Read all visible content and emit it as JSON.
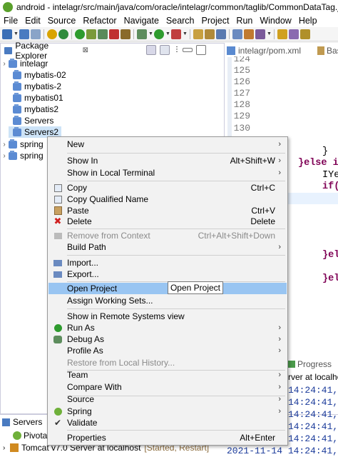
{
  "window": {
    "title": "android - intelagr/src/main/java/com/oracle/intelagr/common/taglib/CommonDataTag.j"
  },
  "menubar": [
    "File",
    "Edit",
    "Source",
    "Refactor",
    "Navigate",
    "Search",
    "Project",
    "Run",
    "Window",
    "Help"
  ],
  "package_explorer": {
    "tab_label": "Package Explorer",
    "close_glyph": "⊠",
    "items": [
      {
        "label": "intelagr",
        "expander": "›"
      },
      {
        "label": "mybatis-02",
        "expander": ""
      },
      {
        "label": "mybatis-2",
        "expander": ""
      },
      {
        "label": "mybatis01",
        "expander": ""
      },
      {
        "label": "mybatis2",
        "expander": ""
      },
      {
        "label": "Servers",
        "expander": ""
      },
      {
        "label": "Servers2",
        "expander": ""
      },
      {
        "label": "spring",
        "expander": "›"
      },
      {
        "label": "spring",
        "expander": "›"
      }
    ]
  },
  "editor": {
    "tab1": "intelagr/pom.xml",
    "tab2": "Bas",
    "line_numbers": [
      "124",
      "125",
      "126",
      "127",
      "128",
      "129",
      "130"
    ],
    "code": [
      "}",
      "}else i",
      "IYe",
      "if(",
      "}el",
      "}el"
    ]
  },
  "lower": {
    "servers_tab": "Servers",
    "pivotal": "Pivota",
    "tomcat": "Tomcat v7.0 Server at localhost",
    "tomcat_state": "[Started, Restart]",
    "progress_tab": "Progress",
    "console_header": "rver at localhost",
    "console_times": [
      "14:24:41,",
      "14:24:41,",
      "14:24:41,",
      "14:24:41,",
      "14:24:41,"
    ],
    "console_last": "2021-11-14 14:24:41,"
  },
  "context_menu": {
    "items": [
      {
        "label": "New",
        "shortcut": "",
        "submenu": true
      },
      {
        "label": "Show In",
        "shortcut": "Alt+Shift+W",
        "submenu": true
      },
      {
        "label": "Show in Local Terminal",
        "shortcut": "",
        "submenu": true
      },
      {
        "label": "Copy",
        "shortcut": "Ctrl+C",
        "submenu": false
      },
      {
        "label": "Copy Qualified Name",
        "shortcut": "",
        "submenu": false
      },
      {
        "label": "Paste",
        "shortcut": "Ctrl+V",
        "submenu": false
      },
      {
        "label": "Delete",
        "shortcut": "Delete",
        "submenu": false
      },
      {
        "label": "Remove from Context",
        "shortcut": "Ctrl+Alt+Shift+Down",
        "submenu": false
      },
      {
        "label": "Build Path",
        "shortcut": "",
        "submenu": true
      },
      {
        "label": "Import...",
        "shortcut": "",
        "submenu": false
      },
      {
        "label": "Export...",
        "shortcut": "",
        "submenu": false
      },
      {
        "label": "Open Project",
        "shortcut": "",
        "submenu": false
      },
      {
        "label": "Assign Working Sets...",
        "shortcut": "",
        "submenu": false
      },
      {
        "label": "Show in Remote Systems view",
        "shortcut": "",
        "submenu": false
      },
      {
        "label": "Run As",
        "shortcut": "",
        "submenu": true
      },
      {
        "label": "Debug As",
        "shortcut": "",
        "submenu": true
      },
      {
        "label": "Profile As",
        "shortcut": "",
        "submenu": true
      },
      {
        "label": "Restore from Local History...",
        "shortcut": "",
        "submenu": false
      },
      {
        "label": "Team",
        "shortcut": "",
        "submenu": true
      },
      {
        "label": "Compare With",
        "shortcut": "",
        "submenu": true
      },
      {
        "label": "Source",
        "shortcut": "",
        "submenu": true
      },
      {
        "label": "Spring",
        "shortcut": "",
        "submenu": true
      },
      {
        "label": "Validate",
        "shortcut": "",
        "submenu": false
      },
      {
        "label": "Properties",
        "shortcut": "Alt+Enter",
        "submenu": false
      }
    ],
    "submenu_glyph": "›",
    "tooltip": "Open Project"
  },
  "colors": {
    "selection": "#99c5f2",
    "keyword": "#7f0055",
    "folder": "#5b8bd3"
  }
}
